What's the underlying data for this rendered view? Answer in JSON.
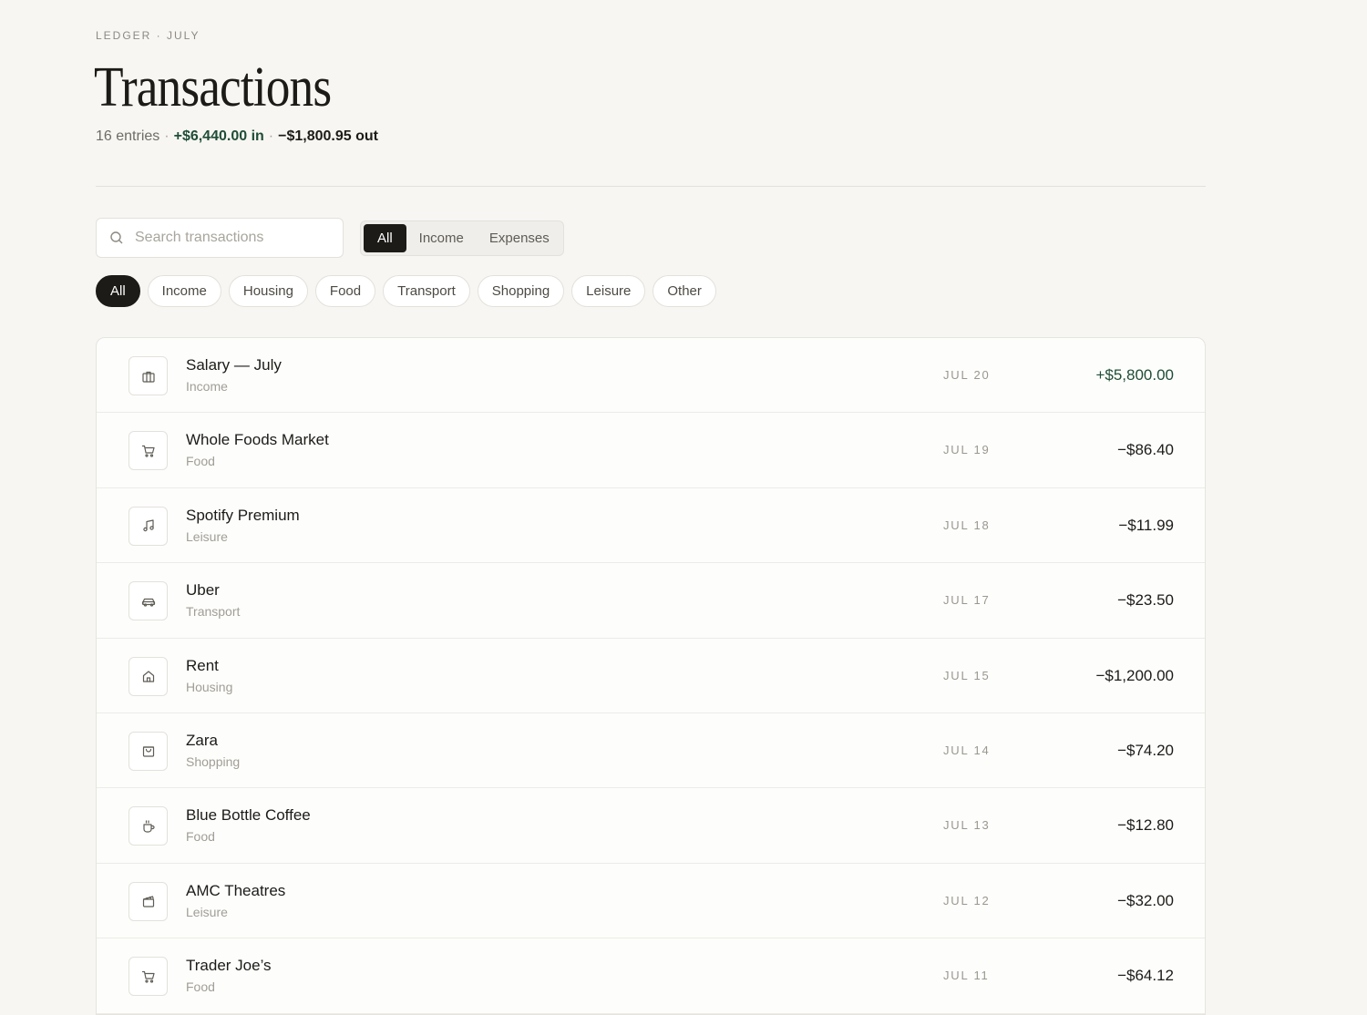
{
  "header": {
    "eyebrow": "LEDGER · JULY",
    "title": "Transactions",
    "summary_entries": "16 entries",
    "summary_in": "+$6,440.00 in",
    "summary_out": "−$1,800.95 out",
    "separator": "·"
  },
  "search": {
    "placeholder": "Search transactions",
    "value": ""
  },
  "type_filter": {
    "options": [
      "All",
      "Income",
      "Expenses"
    ],
    "selected": "All"
  },
  "category_filter": {
    "options": [
      "All",
      "Income",
      "Housing",
      "Food",
      "Transport",
      "Shopping",
      "Leisure",
      "Other"
    ],
    "selected": "All"
  },
  "colors": {
    "accent_dark": "#1c1b17",
    "income_green": "#1f4d36",
    "background": "#f7f6f3"
  },
  "transactions": [
    {
      "name": "Salary — July",
      "category": "Income",
      "date": "JUL 20",
      "amount": "+$5,800.00",
      "icon": "briefcase-icon"
    },
    {
      "name": "Whole Foods Market",
      "category": "Food",
      "date": "JUL 19",
      "amount": "−$86.40",
      "icon": "cart-icon"
    },
    {
      "name": "Spotify Premium",
      "category": "Leisure",
      "date": "JUL 18",
      "amount": "−$11.99",
      "icon": "music-icon"
    },
    {
      "name": "Uber",
      "category": "Transport",
      "date": "JUL 17",
      "amount": "−$23.50",
      "icon": "car-icon"
    },
    {
      "name": "Rent",
      "category": "Housing",
      "date": "JUL 15",
      "amount": "−$1,200.00",
      "icon": "home-icon"
    },
    {
      "name": "Zara",
      "category": "Shopping",
      "date": "JUL 14",
      "amount": "−$74.20",
      "icon": "shopping-bag-icon"
    },
    {
      "name": "Blue Bottle Coffee",
      "category": "Food",
      "date": "JUL 13",
      "amount": "−$12.80",
      "icon": "coffee-icon"
    },
    {
      "name": "AMC Theatres",
      "category": "Leisure",
      "date": "JUL 12",
      "amount": "−$32.00",
      "icon": "clapperboard-icon"
    },
    {
      "name": "Trader Joe’s",
      "category": "Food",
      "date": "JUL 11",
      "amount": "−$64.12",
      "icon": "cart-icon"
    }
  ]
}
